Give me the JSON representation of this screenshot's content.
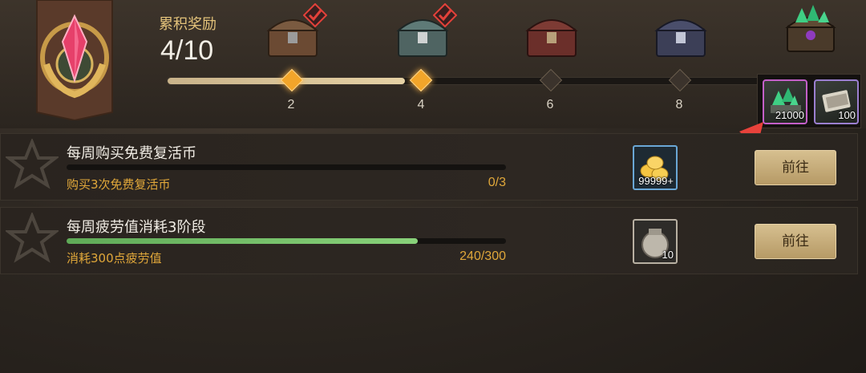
{
  "reward": {
    "label": "累积奖励",
    "progress_text": "4/10",
    "progress_fraction": 0.4,
    "ticks": [
      "2",
      "4",
      "6",
      "8"
    ]
  },
  "final_chest_items": [
    {
      "icon": "green-gem-icon",
      "qty": "21000"
    },
    {
      "icon": "ticket-icon",
      "qty": "100"
    }
  ],
  "tasks": [
    {
      "title": "每周购买免费复活币",
      "desc": "购买3次免费复活币",
      "count": "0/3",
      "progress_fraction": 0,
      "reward_icon": "gold-coin-icon",
      "reward_qty": "99999+",
      "button": "前往"
    },
    {
      "title": "每周疲劳值消耗3阶段",
      "desc": "消耗300点疲劳值",
      "count": "240/300",
      "progress_fraction": 0.8,
      "reward_icon": "jar-icon",
      "reward_qty": "10",
      "button": "前往"
    }
  ],
  "colors": {
    "accent_gold": "#e3c27a",
    "progress_orange": "#f2a52a",
    "task_text": "#e0a73a",
    "button": "#c8ad7b",
    "arrow": "#e8423b"
  }
}
